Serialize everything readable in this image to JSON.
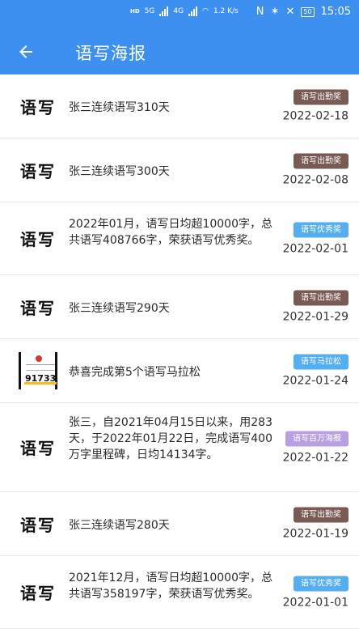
{
  "status_bar": {
    "hd1": "HD",
    "net": "5G",
    "hd2": "HD",
    "net2": "4G",
    "speed": "1.2 K/s",
    "battery": "50",
    "time": "15:05"
  },
  "app_bar": {
    "title": "语写海报"
  },
  "colors": {
    "primary": "#3d8ff0",
    "attendance": "#7a5a55",
    "excellent": "#54aef0",
    "marathon": "#54aef0",
    "million": "#b8a0e2"
  },
  "items": [
    {
      "thumb": "语写",
      "text": "张三连续语写310天",
      "badge": "语写出勤奖",
      "badge_type": "attendance",
      "date": "2022-02-18"
    },
    {
      "thumb": "语写",
      "text": "张三连续语写300天",
      "badge": "语写出勤奖",
      "badge_type": "attendance",
      "date": "2022-02-08"
    },
    {
      "thumb": "语写",
      "text": "2022年01月，语写日均超10000字，总共语写408766字，荣获语写优秀奖。",
      "badge": "语写优秀奖",
      "badge_type": "excellent",
      "date": "2022-02-01"
    },
    {
      "thumb": "语写",
      "text": "张三连续语写290天",
      "badge": "语写出勤奖",
      "badge_type": "attendance",
      "date": "2022-01-29"
    },
    {
      "thumb_poster": "91733",
      "text": "恭喜完成第5个语写马拉松",
      "badge": "语写马拉松",
      "badge_type": "marathon",
      "date": "2022-01-24"
    },
    {
      "thumb": "语写",
      "text": "张三，自2021年04月15日以来，用283天，于2022年01月22日，完成语写400万字里程碑，日均14134字。",
      "badge": "语写百万海报",
      "badge_type": "million",
      "date": "2022-01-22"
    },
    {
      "thumb": "语写",
      "text": "张三连续语写280天",
      "badge": "语写出勤奖",
      "badge_type": "attendance",
      "date": "2022-01-19"
    },
    {
      "thumb": "语写",
      "text": "2021年12月，语写日均超10000字，总共语写358197字，荣获语写优秀奖。",
      "badge": "语写优秀奖",
      "badge_type": "excellent",
      "date": "2022-01-01"
    }
  ]
}
